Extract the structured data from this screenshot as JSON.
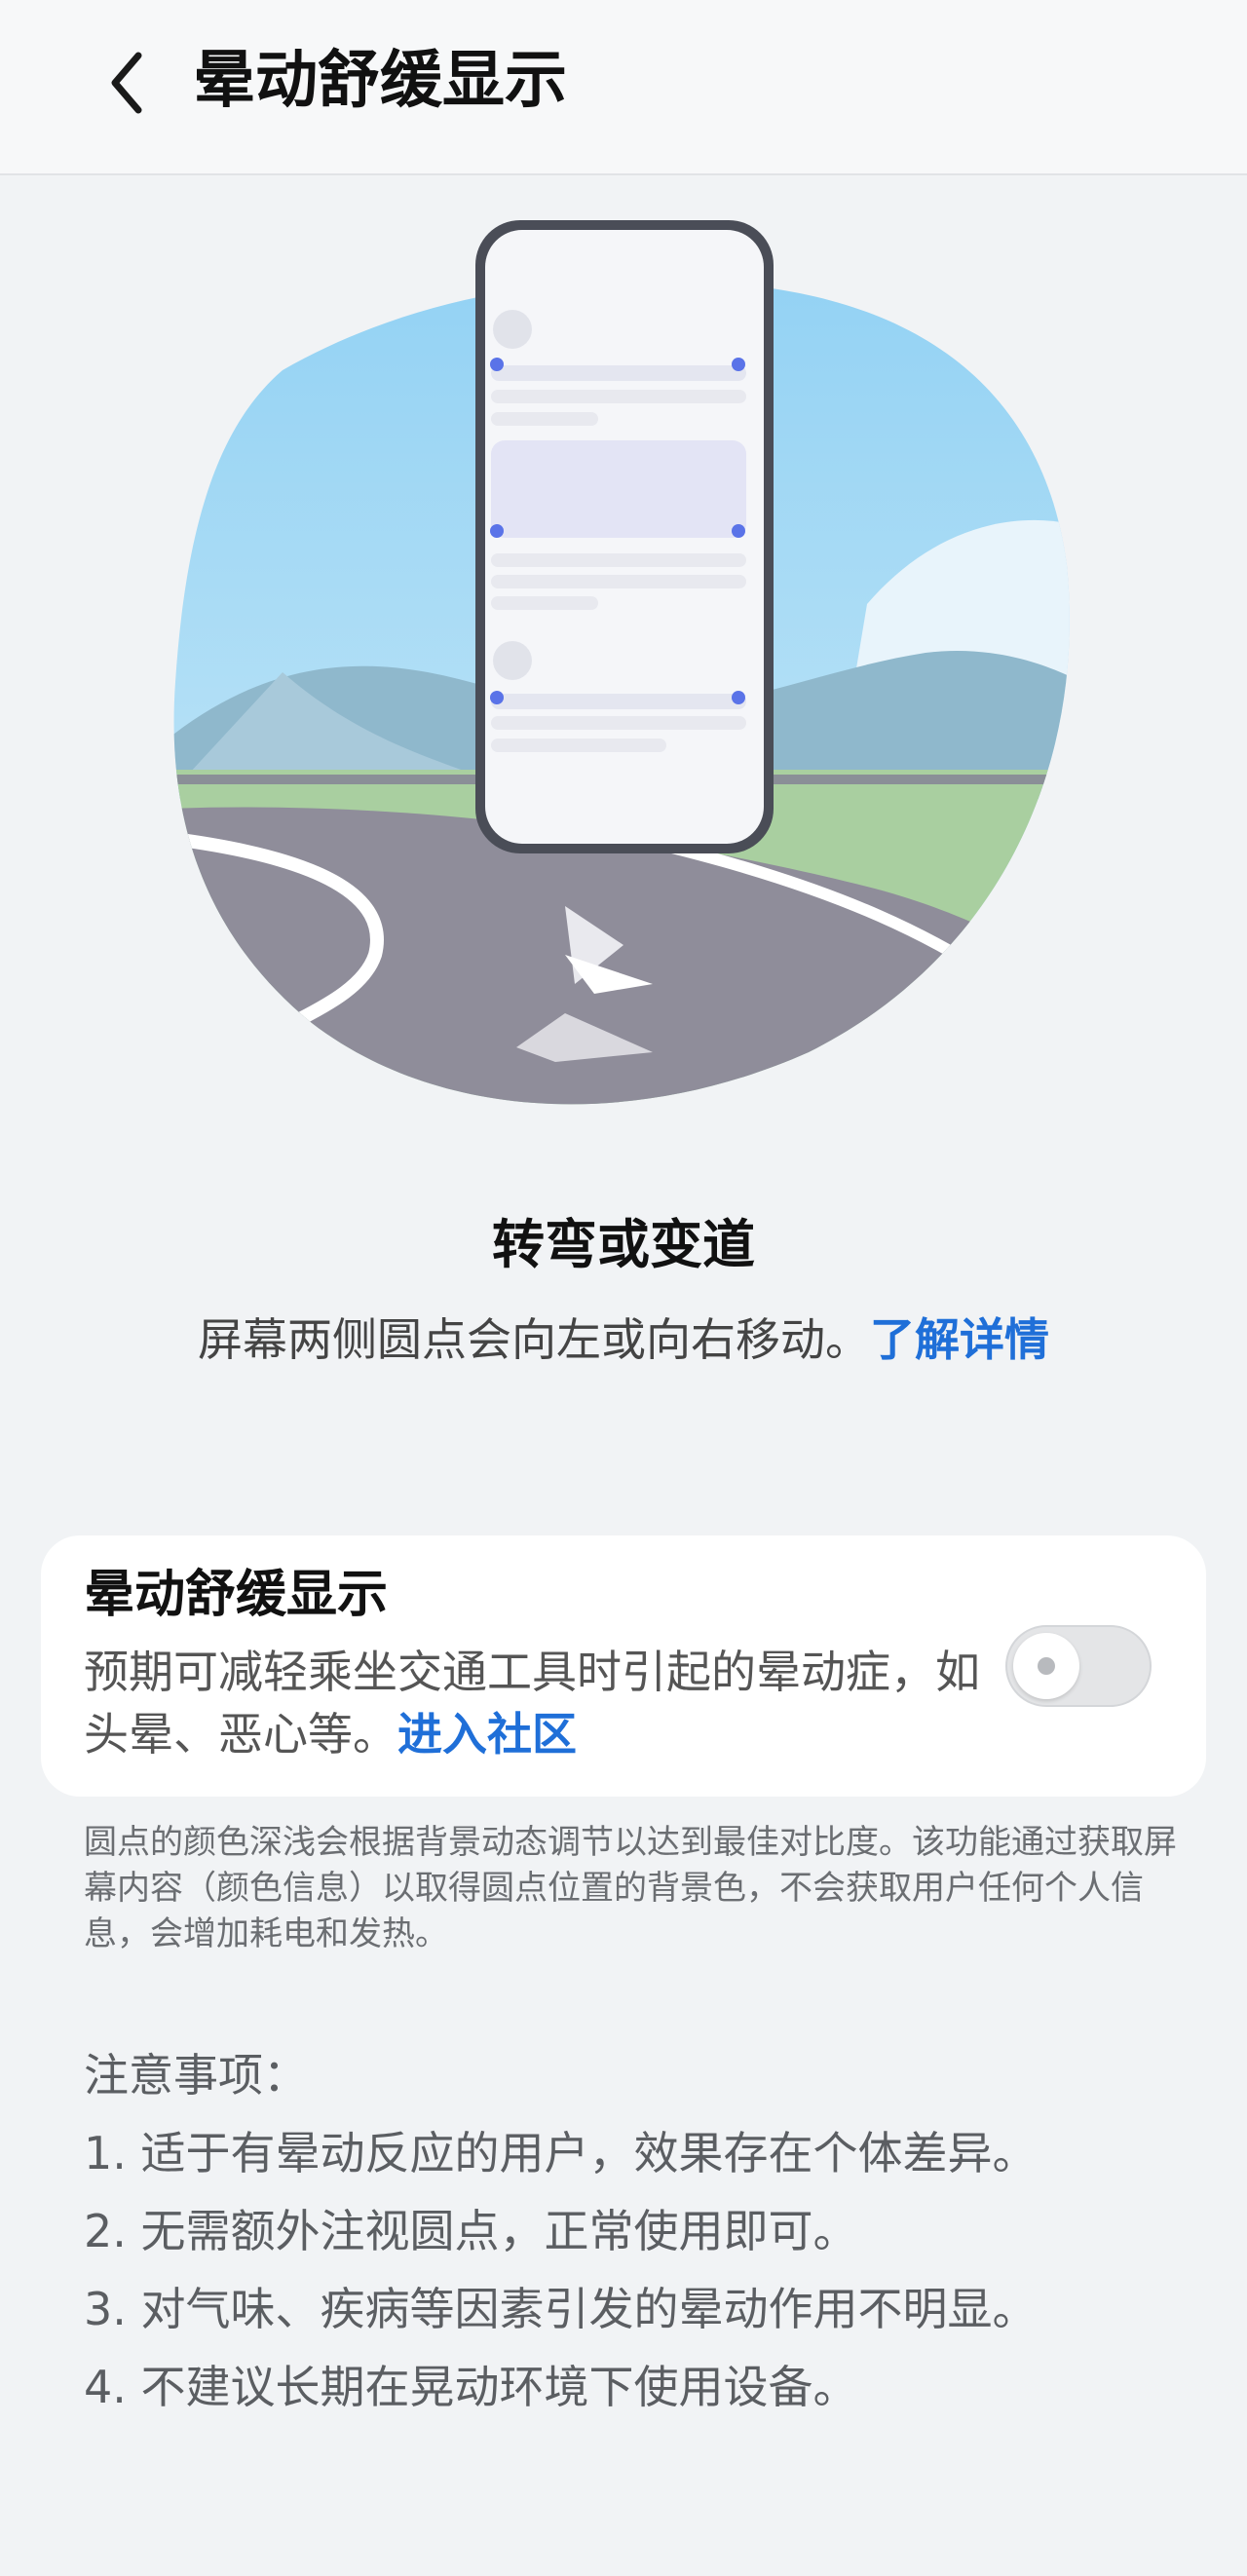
{
  "header": {
    "back_icon": "chevron-left-icon",
    "title": "晕动舒缓显示"
  },
  "intro": {
    "title": "转弯或变道",
    "desc": "屏幕两侧圆点会向左或向右移动。",
    "learn_more": "了解详情"
  },
  "card": {
    "title": "晕动舒缓显示",
    "desc": "预期可减轻乘坐交通工具时引起的晕动症，如头晕、恶心等。",
    "community_link": "进入社区",
    "toggle_on": false
  },
  "footnote": "圆点的颜色深浅会根据背景动态调节以达到最佳对比度。该功能通过获取屏幕内容（颜色信息）以取得圆点位置的背景色，不会获取用户任何个人信息，会增加耗电和发热。",
  "notes": {
    "heading": "注意事项：",
    "items": [
      "1. 适于有晕动反应的用户，效果存在个体差异。",
      "2. 无需额外注视圆点，正常使用即可。",
      "3. 对气味、疾病等因素引发的晕动作用不明显。",
      "4. 不建议长期在晃动环境下使用设备。"
    ]
  },
  "colors": {
    "accent": "#1f6fd8",
    "dot": "#5a73e8",
    "background": "#f1f3f5"
  }
}
